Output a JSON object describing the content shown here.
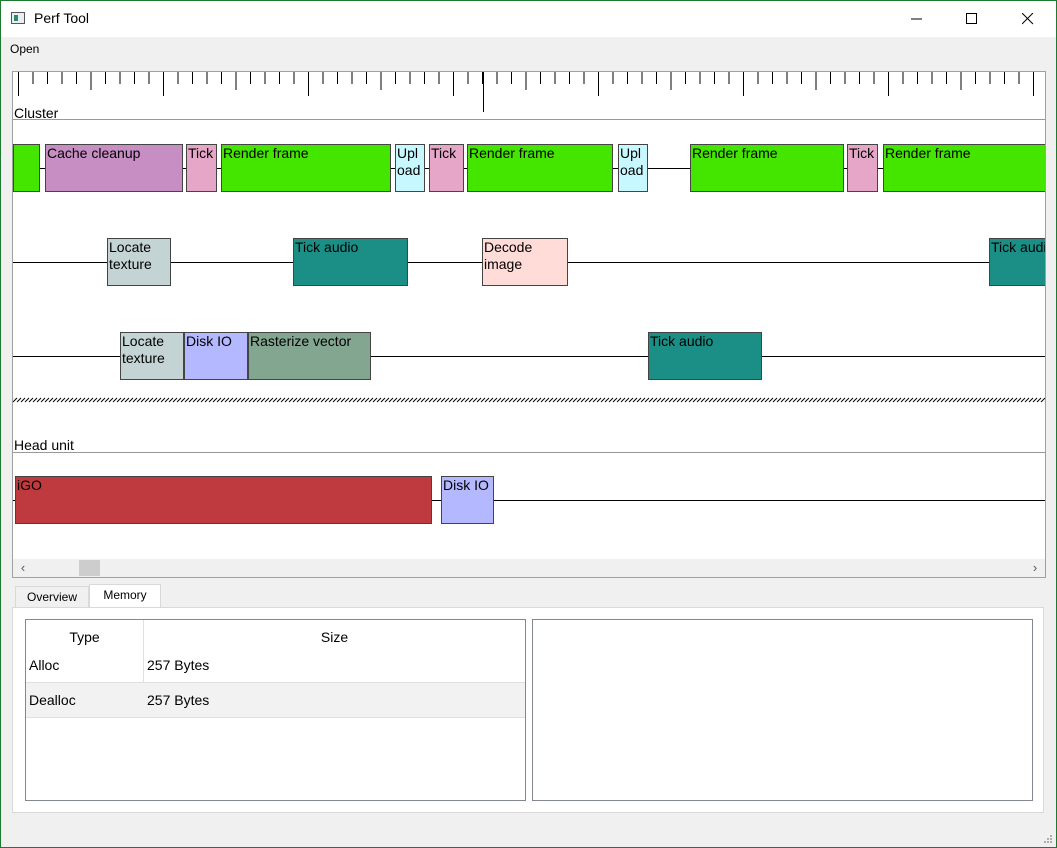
{
  "window": {
    "title": "Perf Tool",
    "accent": "#1e7a2e"
  },
  "icons": {
    "app": "app-icon",
    "minimize": "minimize-icon",
    "maximize": "maximize-icon",
    "close": "close-icon",
    "scroll_left": "chevron-left-icon",
    "scroll_right": "chevron-right-icon",
    "grip": "resize-grip-icon"
  },
  "menu": {
    "open_label": "Open"
  },
  "timeline": {
    "groups": [
      {
        "label": "Cluster"
      },
      {
        "label": "Head unit"
      }
    ],
    "cluster_track1": [
      {
        "label": "",
        "color": "#44e600"
      },
      {
        "label": "Cache cleanup",
        "color": "#c78ec4"
      },
      {
        "label": "Tick",
        "color": "#e6a6c8"
      },
      {
        "label": "Render frame",
        "color": "#44e600"
      },
      {
        "label": "Upl oad",
        "color": "#c8f8ff"
      },
      {
        "label": "Tick",
        "color": "#e6a6c8"
      },
      {
        "label": "Render frame",
        "color": "#44e600"
      },
      {
        "label": "Upl oad",
        "color": "#c8f8ff"
      },
      {
        "label": "Render frame",
        "color": "#44e600"
      },
      {
        "label": "Tick",
        "color": "#e6a6c8"
      },
      {
        "label": "Render frame",
        "color": "#44e600"
      }
    ],
    "cluster_track2": [
      {
        "label": "Locate texture",
        "color": "#c4d4d4"
      },
      {
        "label": "Tick audio",
        "color": "#1b8f86"
      },
      {
        "label": "Decode image",
        "color": "#ffdcd8"
      },
      {
        "label": "Tick audio",
        "color": "#1b8f86"
      }
    ],
    "cluster_track3": [
      {
        "label": "Locate texture",
        "color": "#c4d4d4"
      },
      {
        "label": "Disk IO",
        "color": "#b4b8ff"
      },
      {
        "label": "Rasterize vector",
        "color": "#82a690"
      },
      {
        "label": "Tick audio",
        "color": "#1b8f86"
      }
    ],
    "head_track1": [
      {
        "label": "iGO",
        "color": "#bf3a3e"
      },
      {
        "label": "Disk IO",
        "color": "#b4b8ff"
      }
    ]
  },
  "tabs": [
    {
      "label": "Overview",
      "active": false
    },
    {
      "label": "Memory",
      "active": true
    }
  ],
  "memory_table": {
    "columns": [
      "Type",
      "Size"
    ],
    "rows": [
      {
        "type": "Alloc",
        "size": "257 Bytes"
      },
      {
        "type": "Dealloc",
        "size": "257 Bytes"
      }
    ]
  }
}
